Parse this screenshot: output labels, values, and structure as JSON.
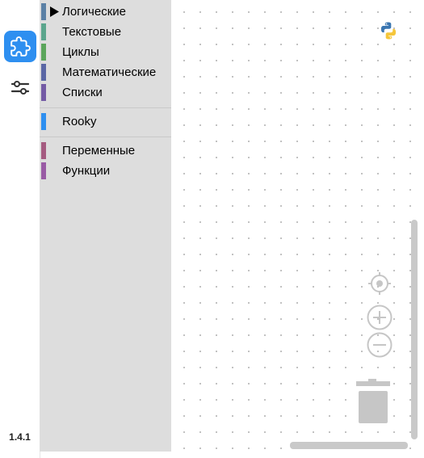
{
  "sidebar": {
    "tabs": [
      {
        "name": "blocks",
        "icon": "puzzle-icon",
        "active": true
      },
      {
        "name": "settings",
        "icon": "sliders-icon",
        "active": false
      }
    ],
    "version": "1.4.1"
  },
  "toolbox": {
    "categories": [
      {
        "label": "Логические",
        "color": "#5b80a5",
        "selected": true
      },
      {
        "label": "Текстовые",
        "color": "#5ba58c"
      },
      {
        "label": "Циклы",
        "color": "#5ba55b"
      },
      {
        "label": "Математические",
        "color": "#5b67a5"
      },
      {
        "label": "Списки",
        "color": "#745ba5"
      },
      {
        "label": "Rooky",
        "color": "#2e8ff0"
      },
      {
        "label": "Переменные",
        "color": "#a55b80"
      },
      {
        "label": "Функции",
        "color": "#995ba5"
      }
    ]
  },
  "workspace": {
    "icons": [
      "python-icon",
      "recenter-icon",
      "zoom-in-icon",
      "zoom-out-icon",
      "trash-icon"
    ]
  },
  "colors": {
    "accent": "#2e8ff0",
    "toolbox_bg": "#dddddd",
    "grid_dot": "#b8b8b8",
    "control_gray": "#c6c6c6"
  }
}
